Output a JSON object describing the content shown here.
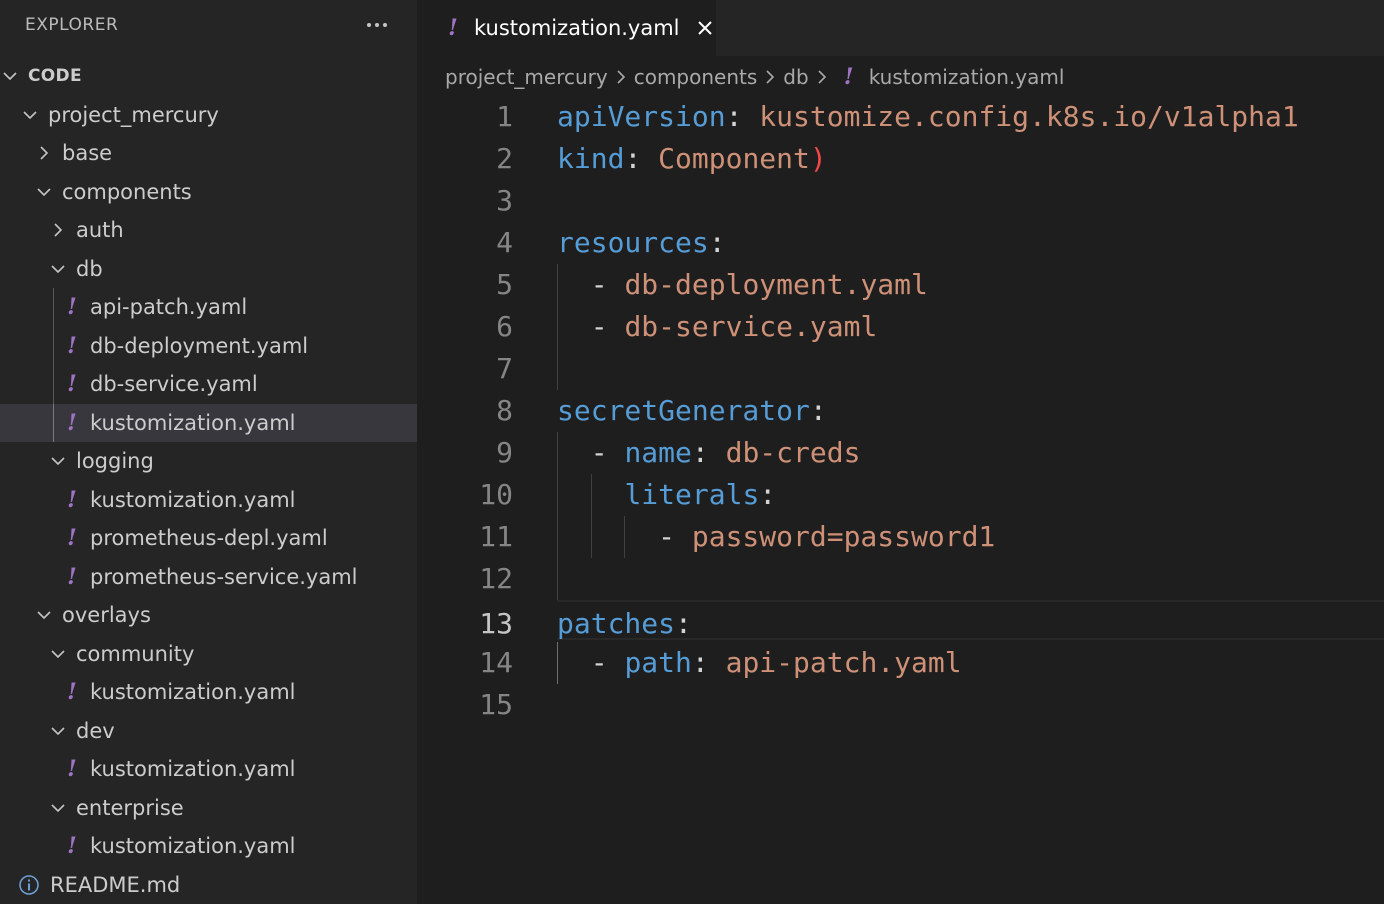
{
  "explorer": {
    "title": "EXPLORER",
    "more_actions_label": "...",
    "section": "CODE",
    "tree": [
      {
        "label": "project_mercury",
        "type": "folder",
        "expanded": true,
        "depth": 1
      },
      {
        "label": "base",
        "type": "folder",
        "expanded": false,
        "depth": 2
      },
      {
        "label": "components",
        "type": "folder",
        "expanded": true,
        "depth": 2
      },
      {
        "label": "auth",
        "type": "folder",
        "expanded": false,
        "depth": 3
      },
      {
        "label": "db",
        "type": "folder",
        "expanded": true,
        "depth": 3
      },
      {
        "label": "api-patch.yaml",
        "type": "yaml",
        "depth": 4
      },
      {
        "label": "db-deployment.yaml",
        "type": "yaml",
        "depth": 4
      },
      {
        "label": "db-service.yaml",
        "type": "yaml",
        "depth": 4
      },
      {
        "label": "kustomization.yaml",
        "type": "yaml",
        "depth": 4,
        "selected": true
      },
      {
        "label": "logging",
        "type": "folder",
        "expanded": true,
        "depth": 3
      },
      {
        "label": "kustomization.yaml",
        "type": "yaml",
        "depth": 4
      },
      {
        "label": "prometheus-depl.yaml",
        "type": "yaml",
        "depth": 4
      },
      {
        "label": "prometheus-service.yaml",
        "type": "yaml",
        "depth": 4
      },
      {
        "label": "overlays",
        "type": "folder",
        "expanded": true,
        "depth": 2
      },
      {
        "label": "community",
        "type": "folder",
        "expanded": true,
        "depth": 3
      },
      {
        "label": "kustomization.yaml",
        "type": "yaml",
        "depth": 4
      },
      {
        "label": "dev",
        "type": "folder",
        "expanded": true,
        "depth": 3
      },
      {
        "label": "kustomization.yaml",
        "type": "yaml",
        "depth": 4
      },
      {
        "label": "enterprise",
        "type": "folder",
        "expanded": true,
        "depth": 3
      },
      {
        "label": "kustomization.yaml",
        "type": "yaml",
        "depth": 4
      },
      {
        "label": "README.md",
        "type": "info",
        "depth": 1
      }
    ]
  },
  "tab": {
    "label": "kustomization.yaml",
    "icon": "!"
  },
  "breadcrumb": [
    "project_mercury",
    "components",
    "db",
    "kustomization.yaml"
  ],
  "editor": {
    "active_line": 13,
    "lines": [
      {
        "n": "1",
        "tokens": [
          {
            "t": "apiVersion",
            "c": "k"
          },
          {
            "t": ": ",
            "c": "p"
          },
          {
            "t": "kustomize.config.k8s.io/v1alpha1",
            "c": "s"
          }
        ]
      },
      {
        "n": "2",
        "tokens": [
          {
            "t": "kind",
            "c": "k"
          },
          {
            "t": ": ",
            "c": "p"
          },
          {
            "t": "Component",
            "c": "s"
          },
          {
            "t": ")",
            "c": "bracket-err"
          }
        ]
      },
      {
        "n": "3",
        "tokens": []
      },
      {
        "n": "4",
        "tokens": [
          {
            "t": "resources",
            "c": "k"
          },
          {
            "t": ":",
            "c": "p"
          }
        ]
      },
      {
        "n": "5",
        "tokens": [
          {
            "t": "  - ",
            "c": "p"
          },
          {
            "t": "db-deployment.yaml",
            "c": "s"
          }
        ]
      },
      {
        "n": "6",
        "tokens": [
          {
            "t": "  - ",
            "c": "p"
          },
          {
            "t": "db-service.yaml",
            "c": "s"
          }
        ]
      },
      {
        "n": "7",
        "tokens": []
      },
      {
        "n": "8",
        "tokens": [
          {
            "t": "secretGenerator",
            "c": "k"
          },
          {
            "t": ":",
            "c": "p"
          }
        ]
      },
      {
        "n": "9",
        "tokens": [
          {
            "t": "  - ",
            "c": "p"
          },
          {
            "t": "name",
            "c": "k"
          },
          {
            "t": ": ",
            "c": "p"
          },
          {
            "t": "db-creds",
            "c": "s"
          }
        ]
      },
      {
        "n": "10",
        "tokens": [
          {
            "t": "    ",
            "c": "p"
          },
          {
            "t": "literals",
            "c": "k"
          },
          {
            "t": ":",
            "c": "p"
          }
        ]
      },
      {
        "n": "11",
        "tokens": [
          {
            "t": "      - ",
            "c": "p"
          },
          {
            "t": "password=password1",
            "c": "s"
          }
        ]
      },
      {
        "n": "12",
        "tokens": []
      },
      {
        "n": "13",
        "tokens": [
          {
            "t": "patches",
            "c": "k"
          },
          {
            "t": ":",
            "c": "p"
          }
        ]
      },
      {
        "n": "14",
        "tokens": [
          {
            "t": "  - ",
            "c": "p"
          },
          {
            "t": "path",
            "c": "k"
          },
          {
            "t": ": ",
            "c": "p"
          },
          {
            "t": "api-patch.yaml",
            "c": "s"
          }
        ]
      },
      {
        "n": "15",
        "tokens": []
      }
    ]
  },
  "colors": {
    "yaml_icon": "#a074c4",
    "key": "#569cd6",
    "string": "#ce9178",
    "error_bracket": "#f44747",
    "selected_row": "#37373d"
  }
}
